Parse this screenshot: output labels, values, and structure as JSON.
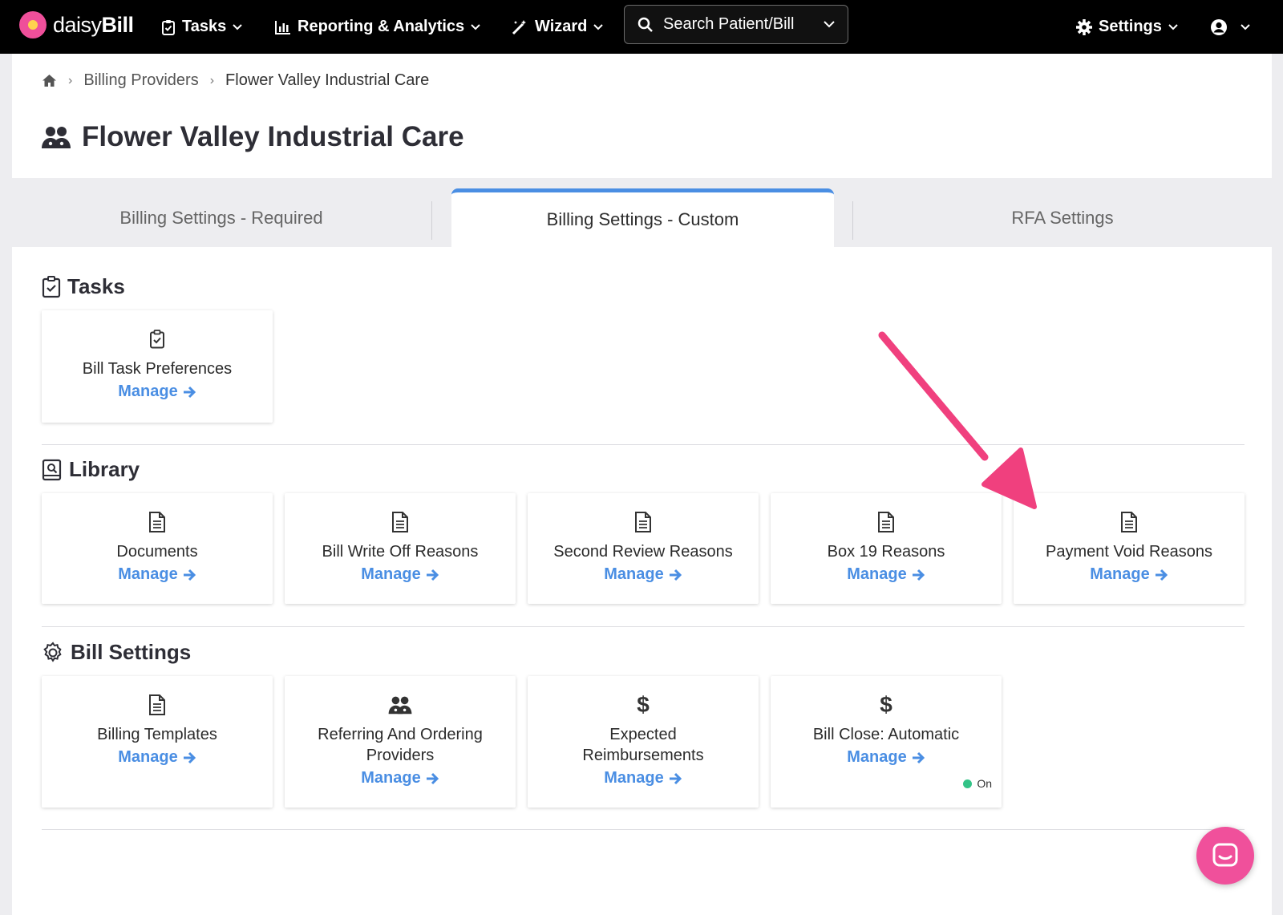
{
  "nav": {
    "brand_light": "daisy",
    "brand_bold": "Bill",
    "tasks": "Tasks",
    "reporting": "Reporting & Analytics",
    "wizard": "Wizard",
    "search_placeholder": "Search Patient/Bill",
    "settings": "Settings"
  },
  "breadcrumb": {
    "parent": "Billing Providers",
    "current": "Flower Valley Industrial Care"
  },
  "page_title": "Flower Valley Industrial Care",
  "tabs": [
    {
      "label": "Billing Settings - Required",
      "active": false
    },
    {
      "label": "Billing Settings - Custom",
      "active": true
    },
    {
      "label": "RFA Settings",
      "active": false
    }
  ],
  "sections": {
    "tasks": {
      "title": "Tasks",
      "cards": [
        {
          "title": "Bill Task Preferences",
          "link": "Manage",
          "icon": "clipboard-check-icon"
        }
      ]
    },
    "library": {
      "title": "Library",
      "cards": [
        {
          "title": "Documents",
          "link": "Manage",
          "icon": "document-icon"
        },
        {
          "title": "Bill Write Off Reasons",
          "link": "Manage",
          "icon": "document-icon"
        },
        {
          "title": "Second Review Reasons",
          "link": "Manage",
          "icon": "document-icon"
        },
        {
          "title": "Box 19 Reasons",
          "link": "Manage",
          "icon": "document-icon"
        },
        {
          "title": "Payment Void Reasons",
          "link": "Manage",
          "icon": "document-icon"
        }
      ]
    },
    "bill_settings": {
      "title": "Bill Settings",
      "cards": [
        {
          "title": "Billing Templates",
          "link": "Manage",
          "icon": "document-icon"
        },
        {
          "title": "Referring And Ordering Providers",
          "link": "Manage",
          "icon": "doctors-icon"
        },
        {
          "title": "Expected Reimbursements",
          "link": "Manage",
          "icon": "dollar-icon",
          "icon_text": "$"
        },
        {
          "title": "Bill Close: Automatic",
          "link": "Manage",
          "icon": "dollar-icon",
          "icon_text": "$",
          "status": "On"
        }
      ]
    }
  },
  "colors": {
    "accent": "#4a8ee3",
    "annotation_arrow": "#f0407e",
    "status_on": "#33c387",
    "chat": "#f0509b"
  }
}
